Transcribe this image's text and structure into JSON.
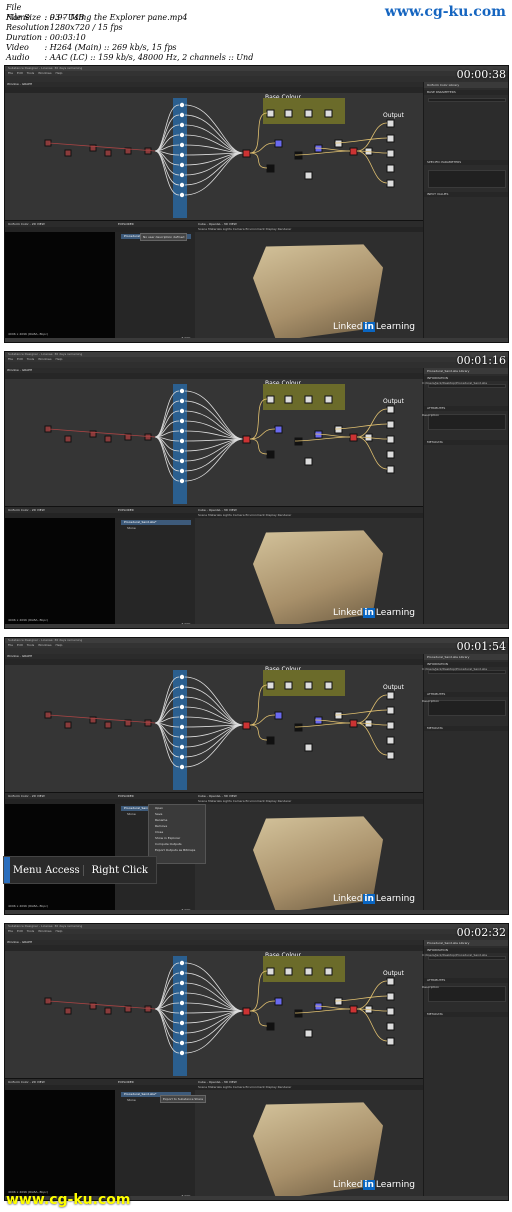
{
  "file_info": [
    {
      "key": "File Name",
      "value": "03 - Using the Explorer pane.mp4"
    },
    {
      "key": "File Size",
      "value": "9.97 MB"
    },
    {
      "key": "Resolution",
      "value": "1280x720 / 15 fps"
    },
    {
      "key": "Duration",
      "value": "00:03:10"
    },
    {
      "key": "Video",
      "value": "H264 (Main) :: 269 kb/s, 15 fps"
    },
    {
      "key": "Audio",
      "value": "AAC (LC) :: 159 kb/s, 48000 Hz, 2 channels :: Und"
    }
  ],
  "watermark": "www.cg-ku.com",
  "app_title": "Substance Designer - License: 30 days remaining",
  "menu_items": [
    "File",
    "Edit",
    "Tools",
    "Windows",
    "Help"
  ],
  "graph_title": "Window - GRAPH",
  "labels": {
    "r1": "R1",
    "r2": "R2",
    "base_colour": "Base Colour",
    "output": "Output"
  },
  "panels": {
    "view2d": "Uniform Color - 2D VIEW",
    "explorer": "EXPLORER",
    "view3d": "Cube - OpenGL - 3D VIEW",
    "view3d_menu": "Scene  Materials  Lights  Camera  Environment  Display  Renderer",
    "resolution_2d": "4096 x 4096 (RGBA, 8bpc)",
    "zoom": "8.00%"
  },
  "frames": [
    {
      "timestamp": "00:00:38",
      "right_tabs": "Uniform Color   Library",
      "sections": [
        "BASE PARAMETERS",
        "SPECIFIC PARAMETERS",
        "INPUT VALUES"
      ],
      "tree": [
        "Procedural_Sand.sbs*"
      ],
      "tooltip": "No user description defined"
    },
    {
      "timestamp": "00:01:16",
      "right_tabs": "Procedural_Sand.sbs   Library",
      "sections": [
        "INFORMATION",
        "ATTRIBUTES",
        "METADATA"
      ],
      "tree": [
        "Procedural_Sand.sbs*",
        "Stone"
      ],
      "path": "C:/Users/Jack/Desktop/Procedural_Sand.sbs",
      "description": "Description"
    },
    {
      "timestamp": "00:01:54",
      "right_tabs": "Procedural_Sand.sbs   Library",
      "sections": [
        "INFORMATION",
        "ATTRIBUTES",
        "METADATA"
      ],
      "tree": [
        "Procedural_Sand.sbs*",
        "Stone"
      ],
      "path": "C:/Users/Jack/Desktop/Procedural_Sand.sbs",
      "description": "Description"
    },
    {
      "timestamp": "00:02:32",
      "right_tabs": "Procedural_Sand.sbs   Library",
      "sections": [
        "INFORMATION",
        "ATTRIBUTES",
        "METADATA"
      ],
      "tree": [
        "Procedural_Sand.sbs*",
        "Stone"
      ],
      "path": "C:/Users/Jack/Desktop/Procedural_Sand.sbs",
      "description": "Description",
      "tooltip": "Export to Substance Share"
    }
  ],
  "context_menu": [
    "Open",
    "Save",
    "Rename",
    "Remove",
    "Close",
    "Show in Explorer",
    "Compute Outputs",
    "Export Outputs as Bitmaps"
  ],
  "callout": {
    "left": "Menu Access",
    "right": "Right Click"
  },
  "linkedin": {
    "brand_pre": "Linked",
    "brand_in": "in",
    "brand_post": "Learning"
  },
  "colors": {
    "accent": "#2a6ebd",
    "watermark_top": "#1565c0",
    "watermark_bottom": "#ffff00",
    "frame_bg": "#2a2a2a"
  }
}
